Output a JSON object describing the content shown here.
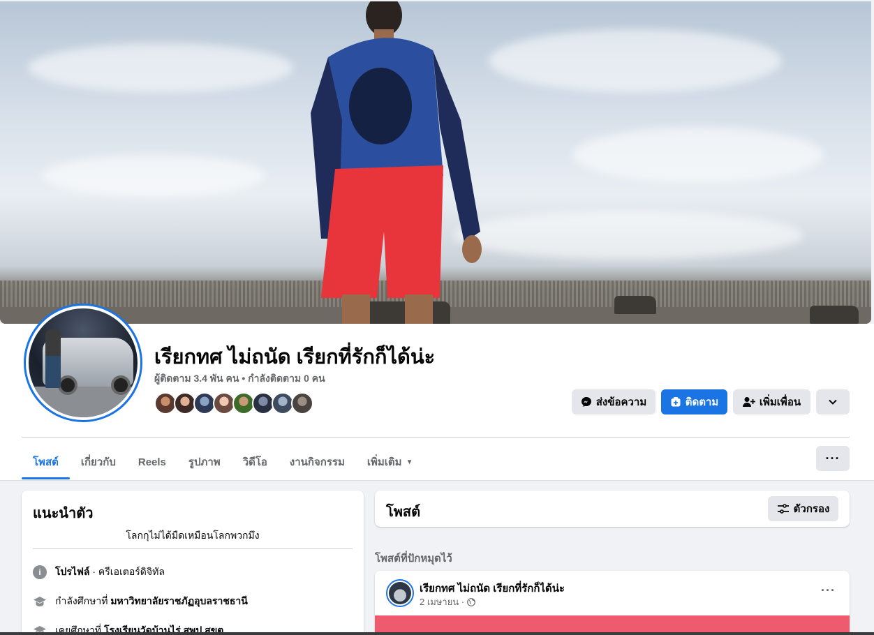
{
  "profile": {
    "name": "เรียกทศ ไม่ถนัด เรียกที่รักก็ได้น่ะ",
    "stats": "ผู้ติดตาม 3.4 พัน คน • กำลังติดตาม 0 คน"
  },
  "actions": {
    "message": "ส่งข้อความ",
    "follow": "ติดตาม",
    "add_friend": "เพิ่มเพื่อน"
  },
  "tabs": [
    {
      "label": "โพสต์"
    },
    {
      "label": "เกี่ยวกับ"
    },
    {
      "label": "Reels"
    },
    {
      "label": "รูปภาพ"
    },
    {
      "label": "วิดีโอ"
    },
    {
      "label": "งานกิจกรรม"
    },
    {
      "label": "เพิ่มเติม"
    }
  ],
  "intro": {
    "title": "แนะนำตัว",
    "bio": "โลกกุไม่ได้มืดเหมือนโลกพวกมึง",
    "profile_label": "โปรไฟล์",
    "profile_value": " · ครีเอเตอร์ดิจิทัล",
    "studying_prefix": "กำลังศึกษาที่ ",
    "studying_value": "มหาวิทยาลัยราชภัฏอุบลราชธานี",
    "studied_prefix": "เคยศึกษาที่ ",
    "studied_value": "โรงเรียนวัดบ้านไร่ สพป.สขต"
  },
  "posts": {
    "title": "โพสต์",
    "filter": "ตัวกรอง",
    "pinned_label": "โพสต์ที่ปักหมุดไว้",
    "pinned": {
      "author": "เรียกทศ ไม่ถนัด เรียกที่รักก็ได้น่ะ",
      "date": "2 เมษายน ·"
    }
  },
  "colors": {
    "accent": "#1b74e4",
    "page_bg": "#f0f2f5",
    "button_grey": "#e4e6eb"
  },
  "icons": [
    "messenger-icon",
    "follow-icon",
    "add-friend-icon",
    "chevron-down-icon",
    "more-icon",
    "info-icon",
    "graduation-cap-icon",
    "filter-icon",
    "globe-icon"
  ]
}
